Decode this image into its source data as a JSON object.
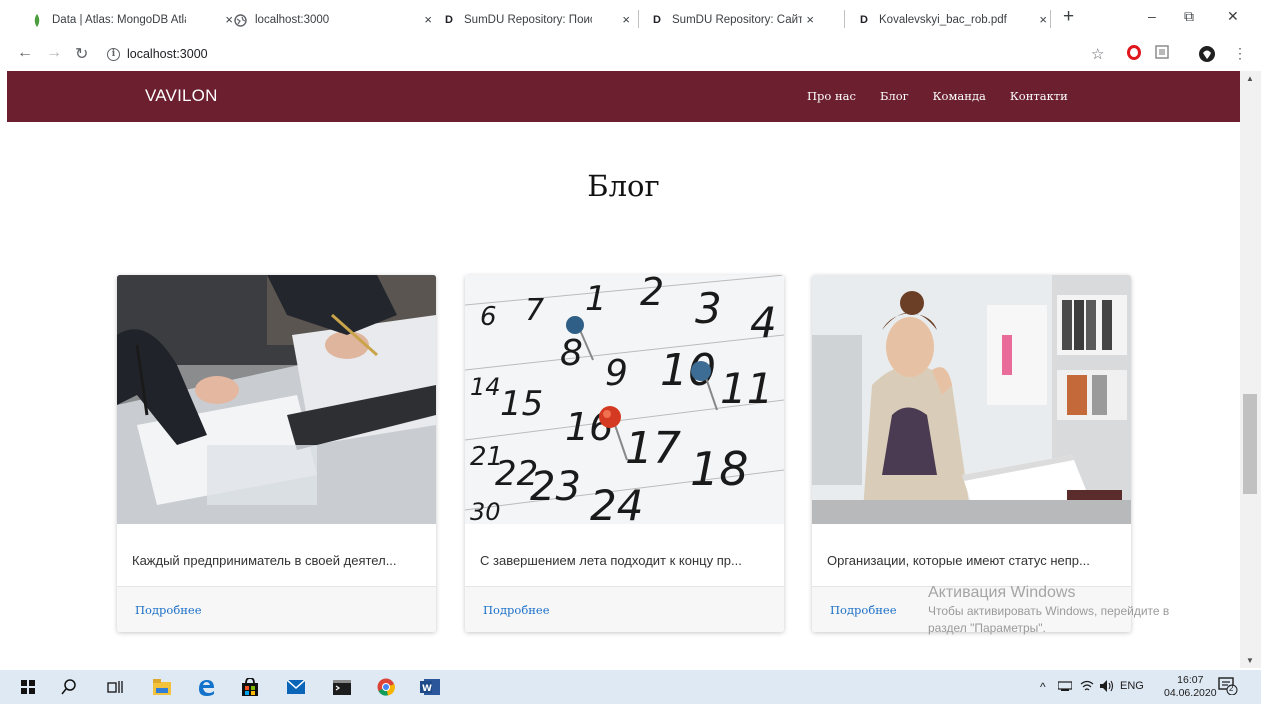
{
  "browser": {
    "tabs": [
      {
        "title": "Data | Atlas: MongoDB Atlas",
        "icon": "mongodb-leaf-icon",
        "active": false
      },
      {
        "title": "localhost:3000",
        "icon": "globe-icon",
        "active": true
      },
      {
        "title": "SumDU Repository: Поиск",
        "icon": "dspace-icon",
        "active": false
      },
      {
        "title": "SumDU Repository: Сайт-візит",
        "icon": "dspace-icon",
        "active": false
      },
      {
        "title": "Kovalevskyi_bac_rob.pdf",
        "icon": "dspace-icon",
        "active": false
      }
    ],
    "close_glyph": "×",
    "new_tab_glyph": "+",
    "url": "localhost:3000",
    "nav_icons": [
      "back-arrow-icon",
      "forward-arrow-icon",
      "reload-icon",
      "info-icon"
    ],
    "window_controls": {
      "minimize": "–",
      "maximize": "⧉",
      "close": "✕"
    }
  },
  "site": {
    "brand": "VAVILON",
    "brand_color": "#6b1f2f",
    "nav": [
      "Про нас",
      "Блог",
      "Команда",
      "Контакти"
    ],
    "section_title": "Блог",
    "cards": [
      {
        "image": "business-documents-signing-photo",
        "text": "Каждый предприниматель в своей деятел...",
        "link": "Подробнее"
      },
      {
        "image": "calendar-with-pushpins-photo",
        "text": "С завершением лета подходит к концу пр...",
        "link": "Подробнее"
      },
      {
        "image": "woman-reading-documents-office-photo",
        "text": "Организации, которые имеют статус непр...",
        "link": "Подробнее"
      }
    ],
    "link_color": "#1a6fc7"
  },
  "windows_activation": {
    "title": "Активация Windows",
    "line1": "Чтобы активировать Windows, перейдите в",
    "line2": "раздел \"Параметры\"."
  },
  "taskbar": {
    "apps": [
      "windows-start-icon",
      "search-icon",
      "task-view-icon",
      "file-explorer-icon",
      "edge-icon",
      "store-icon",
      "mail-icon",
      "terminal-icon",
      "chrome-icon",
      "word-icon"
    ],
    "tray_language": "ENG",
    "time": "16:07",
    "date": "04.06.2020",
    "notification_count": "2"
  }
}
